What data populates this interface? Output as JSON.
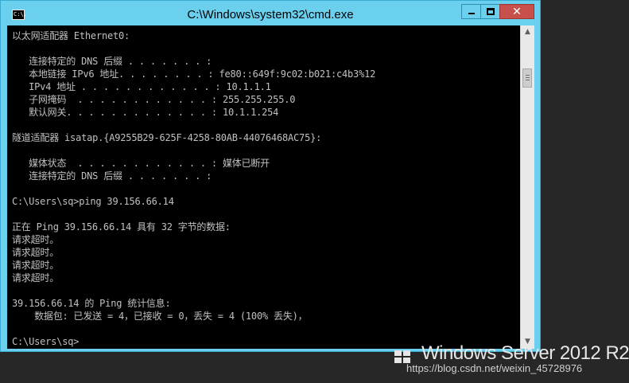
{
  "window": {
    "title": "C:\\Windows\\system32\\cmd.exe",
    "icon_text": "C:\\.",
    "buttons": {
      "minimize": "minimize-icon",
      "maximize": "maximize-icon",
      "close": "✕"
    }
  },
  "console": {
    "lines": [
      "以太网适配器 Ethernet0:",
      "",
      "   连接特定的 DNS 后缀 . . . . . . . :",
      "   本地链接 IPv6 地址. . . . . . . . : fe80::649f:9c02:b021:c4b3%12",
      "   IPv4 地址 . . . . . . . . . . . . : 10.1.1.1",
      "   子网掩码  . . . . . . . . . . . . : 255.255.255.0",
      "   默认网关. . . . . . . . . . . . . : 10.1.1.254",
      "",
      "隧道适配器 isatap.{A9255B29-625F-4258-80AB-44076468AC75}:",
      "",
      "   媒体状态  . . . . . . . . . . . . : 媒体已断开",
      "   连接特定的 DNS 后缀 . . . . . . . :",
      "",
      "C:\\Users\\sq>ping 39.156.66.14",
      "",
      "正在 Ping 39.156.66.14 具有 32 字节的数据:",
      "请求超时。",
      "请求超时。",
      "请求超时。",
      "请求超时。",
      "",
      "39.156.66.14 的 Ping 统计信息:",
      "    数据包: 已发送 = 4，已接收 = 0，丢失 = 4 (100% 丢失)，",
      "",
      "C:\\Users\\sq>"
    ]
  },
  "desktop": {
    "brand": "Windows Server 2012 R2",
    "watermark": "https://blog.csdn.net/weixin_45728976"
  },
  "colors": {
    "titlebar": "#6ad0ee",
    "console_bg": "#000000",
    "console_text": "#c0c0c0",
    "close_button": "#c7504a",
    "desktop_bg": "#272727"
  }
}
